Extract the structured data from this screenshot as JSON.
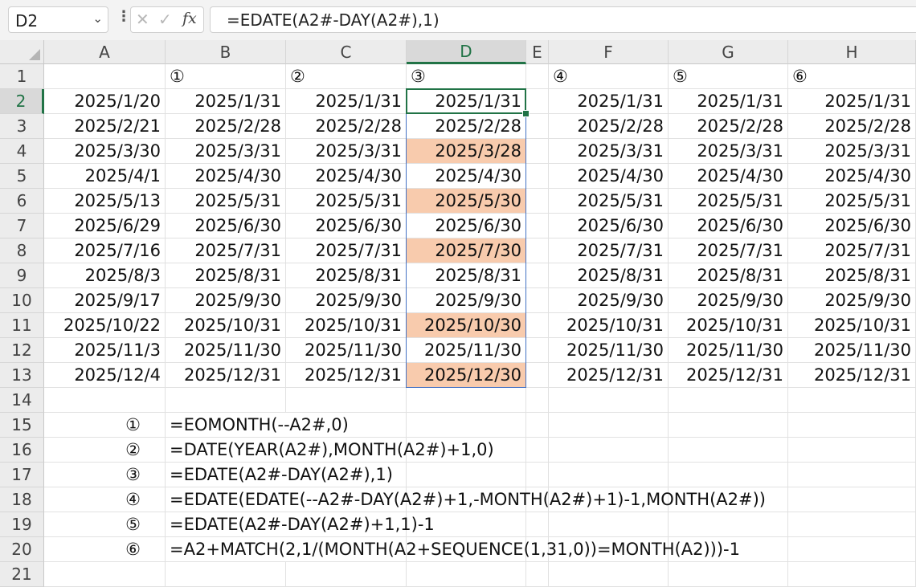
{
  "formula_bar": {
    "name_box": "D2",
    "dropdown_icon": "chevron-down-icon",
    "cancel_icon": "✕",
    "enter_icon": "✓",
    "fx_label": "fx",
    "formula": "=EDATE(A2#-DAY(A2#),1)"
  },
  "sheet": {
    "columns": [
      "A",
      "B",
      "C",
      "D",
      "E",
      "F",
      "G",
      "H"
    ],
    "selected_column": "D",
    "selected_row": "2",
    "row_numbers": [
      "1",
      "2",
      "3",
      "4",
      "5",
      "6",
      "7",
      "8",
      "9",
      "10",
      "11",
      "12",
      "13",
      "14",
      "15",
      "16",
      "17",
      "18",
      "19",
      "20",
      "21"
    ],
    "header_row": [
      "",
      "①",
      "②",
      "③",
      "",
      "④",
      "⑤",
      "⑥"
    ],
    "data_rows": [
      [
        "2025/1/20",
        "2025/1/31",
        "2025/1/31",
        "2025/1/31",
        "",
        "2025/1/31",
        "2025/1/31",
        "2025/1/31"
      ],
      [
        "2025/2/21",
        "2025/2/28",
        "2025/2/28",
        "2025/2/28",
        "",
        "2025/2/28",
        "2025/2/28",
        "2025/2/28"
      ],
      [
        "2025/3/30",
        "2025/3/31",
        "2025/3/31",
        "2025/3/28",
        "",
        "2025/3/31",
        "2025/3/31",
        "2025/3/31"
      ],
      [
        "2025/4/1",
        "2025/4/30",
        "2025/4/30",
        "2025/4/30",
        "",
        "2025/4/30",
        "2025/4/30",
        "2025/4/30"
      ],
      [
        "2025/5/13",
        "2025/5/31",
        "2025/5/31",
        "2025/5/30",
        "",
        "2025/5/31",
        "2025/5/31",
        "2025/5/31"
      ],
      [
        "2025/6/29",
        "2025/6/30",
        "2025/6/30",
        "2025/6/30",
        "",
        "2025/6/30",
        "2025/6/30",
        "2025/6/30"
      ],
      [
        "2025/7/16",
        "2025/7/31",
        "2025/7/31",
        "2025/7/30",
        "",
        "2025/7/31",
        "2025/7/31",
        "2025/7/31"
      ],
      [
        "2025/8/3",
        "2025/8/31",
        "2025/8/31",
        "2025/8/31",
        "",
        "2025/8/31",
        "2025/8/31",
        "2025/8/31"
      ],
      [
        "2025/9/17",
        "2025/9/30",
        "2025/9/30",
        "2025/9/30",
        "",
        "2025/9/30",
        "2025/9/30",
        "2025/9/30"
      ],
      [
        "2025/10/22",
        "2025/10/31",
        "2025/10/31",
        "2025/10/30",
        "",
        "2025/10/31",
        "2025/10/31",
        "2025/10/31"
      ],
      [
        "2025/11/3",
        "2025/11/30",
        "2025/11/30",
        "2025/11/30",
        "",
        "2025/11/30",
        "2025/11/30",
        "2025/11/30"
      ],
      [
        "2025/12/4",
        "2025/12/31",
        "2025/12/31",
        "2025/12/30",
        "",
        "2025/12/31",
        "2025/12/31",
        "2025/12/31"
      ]
    ],
    "highlighted_rows_col_d": [
      4,
      6,
      8,
      11,
      13
    ],
    "highlight_color": "#f8cbad",
    "accent_color": "#217346",
    "formula_notes": [
      {
        "mark": "①",
        "formula": "=EOMONTH(--A2#,0)"
      },
      {
        "mark": "②",
        "formula": "=DATE(YEAR(A2#),MONTH(A2#)+1,0)"
      },
      {
        "mark": "③",
        "formula": "=EDATE(A2#-DAY(A2#),1)"
      },
      {
        "mark": "④",
        "formula": "=EDATE(EDATE(--A2#-DAY(A2#)+1,-MONTH(A2#)+1)-1,MONTH(A2#))"
      },
      {
        "mark": "⑤",
        "formula": "=EDATE(A2#-DAY(A2#)+1,1)-1"
      },
      {
        "mark": "⑥",
        "formula": "=A2+MATCH(2,1/(MONTH(A2+SEQUENCE(1,31,0))=MONTH(A2)))-1"
      }
    ]
  }
}
